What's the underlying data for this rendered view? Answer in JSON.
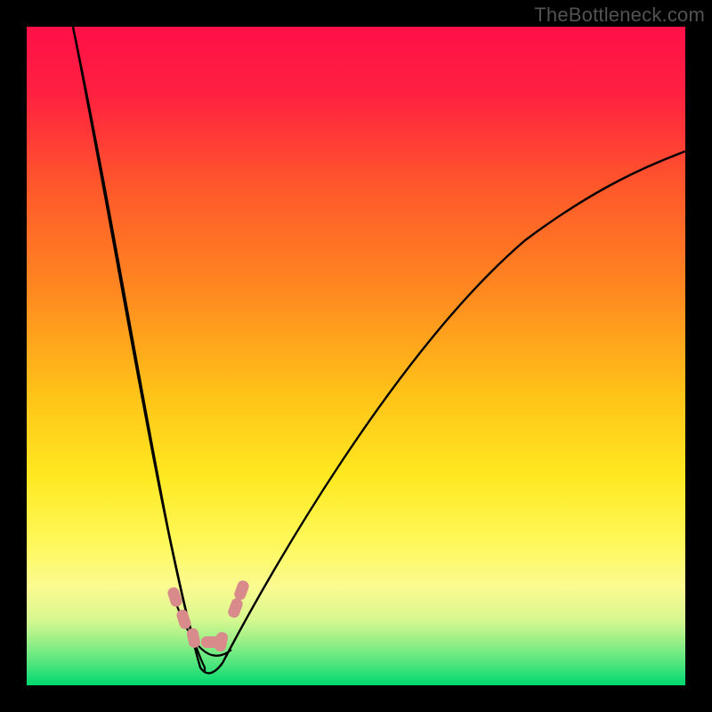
{
  "watermark": "TheBottleneck.com",
  "chart_data": {
    "type": "line",
    "title": "",
    "xlabel": "",
    "ylabel": "",
    "xlim": [
      0,
      100
    ],
    "ylim": [
      0,
      100
    ],
    "description": "Bottleneck curve plot on gradient spectrum from red (high bottleneck) to green (low bottleneck). Curve minimum near x=27 indicates optimal match point.",
    "gradient_stops": [
      {
        "offset": 0,
        "color": "#ff1048"
      },
      {
        "offset": 10,
        "color": "#ff2040"
      },
      {
        "offset": 25,
        "color": "#ff5a2a"
      },
      {
        "offset": 40,
        "color": "#ff8820"
      },
      {
        "offset": 55,
        "color": "#ffc018"
      },
      {
        "offset": 68,
        "color": "#ffe820"
      },
      {
        "offset": 78,
        "color": "#fff858"
      },
      {
        "offset": 85,
        "color": "#fbfb90"
      },
      {
        "offset": 90,
        "color": "#d8f890"
      },
      {
        "offset": 93,
        "color": "#a0f088"
      },
      {
        "offset": 96,
        "color": "#60e880"
      },
      {
        "offset": 98,
        "color": "#30e078"
      },
      {
        "offset": 100,
        "color": "#00d870"
      }
    ],
    "curve": {
      "left_start": {
        "x": 7,
        "y": 0
      },
      "minimum": {
        "x": 27,
        "y": 98
      },
      "right_end": {
        "x": 100,
        "y": 19
      }
    },
    "markers": [
      {
        "x": 22.2,
        "y": 86.2
      },
      {
        "x": 23.5,
        "y": 89.5
      },
      {
        "x": 25.0,
        "y": 92.3
      },
      {
        "x": 27.0,
        "y": 93.3
      },
      {
        "x": 29.0,
        "y": 92.8
      },
      {
        "x": 31.3,
        "y": 87.8
      },
      {
        "x": 32.3,
        "y": 85.2
      }
    ],
    "marker_color": "#d98a8a"
  }
}
